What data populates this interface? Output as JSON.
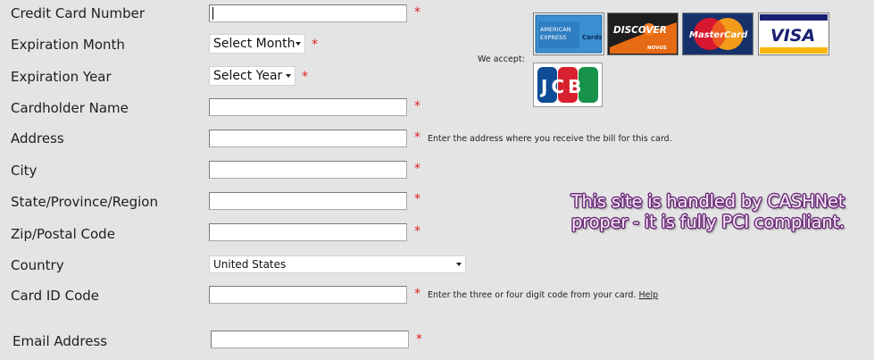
{
  "form": {
    "credit_card_number": {
      "label": "Credit Card Number",
      "value": ""
    },
    "expiration_month": {
      "label": "Expiration Month",
      "selected": "Select Month"
    },
    "expiration_year": {
      "label": "Expiration Year",
      "selected": "Select Year"
    },
    "cardholder_name": {
      "label": "Cardholder Name",
      "value": ""
    },
    "address": {
      "label": "Address",
      "value": "",
      "hint": "Enter the address where you receive the bill for this card."
    },
    "city": {
      "label": "City",
      "value": ""
    },
    "state": {
      "label": "State/Province/Region",
      "value": ""
    },
    "zip": {
      "label": "Zip/Postal Code",
      "value": ""
    },
    "country": {
      "label": "Country",
      "selected": "United States"
    },
    "card_id": {
      "label": "Card ID Code",
      "value": "",
      "hint": "Enter the three or four digit code from your card.",
      "help_link": "Help"
    },
    "email": {
      "label": "Email Address",
      "value": ""
    },
    "required_marker": "*"
  },
  "cards": {
    "accept_label": "We accept:",
    "items": [
      {
        "name": "American Express",
        "icon": "amex-logo",
        "text_line1": "AMERICAN",
        "text_line2": "EXPRESS",
        "text_line3": "Cards"
      },
      {
        "name": "Discover",
        "icon": "discover-logo",
        "text": "DISCOVER",
        "subtext": "NOVUS"
      },
      {
        "name": "MasterCard",
        "icon": "mastercard-logo",
        "text": "MasterCard"
      },
      {
        "name": "Visa",
        "icon": "visa-logo",
        "text": "VISA"
      },
      {
        "name": "JCB",
        "icon": "jcb-logo",
        "text": "JCB"
      }
    ]
  },
  "annotation": {
    "line1": "This site is handled by CASHNet",
    "line2": "proper - it is fully PCI compliant."
  },
  "colors": {
    "background": "#e4e4e4",
    "required": "#e02020",
    "annotation_fill": "#fbeaf8",
    "annotation_outline": "#6a2d79"
  }
}
